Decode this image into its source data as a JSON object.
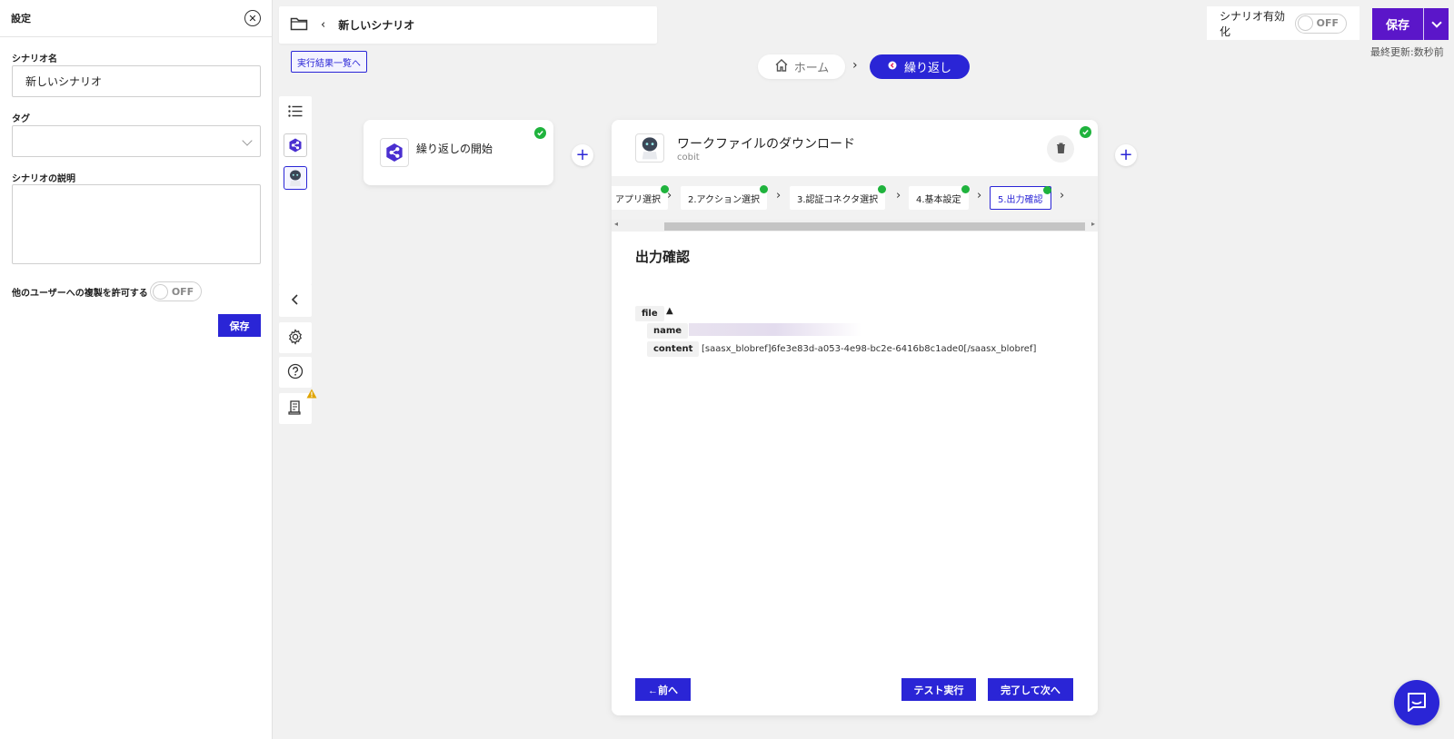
{
  "settings": {
    "title": "設定",
    "scenario_name_label": "シナリオ名",
    "scenario_name_value": "新しいシナリオ",
    "tag_label": "タグ",
    "tag_value": "",
    "description_label": "シナリオの説明",
    "description_value": "",
    "allow_copy_label": "他のユーザーへの複製を許可する",
    "allow_copy_toggle": "OFF",
    "save_label": "保存"
  },
  "topbar": {
    "scenario_name": "新しいシナリオ",
    "results_link": "実行結果一覧へ"
  },
  "breadcrumb": {
    "home": "ホーム",
    "current": "繰り返し"
  },
  "header_right": {
    "enable_label": "シナリオ有効化",
    "enable_toggle": "OFF",
    "save_label": "保存",
    "last_updated": "最終更新:数秒前"
  },
  "nodes": {
    "start_title": "繰り返しの開始",
    "main_title": "ワークファイルのダウンロード",
    "main_subtitle": "cobit"
  },
  "steps": [
    {
      "label": "アプリ選択"
    },
    {
      "label": "2.アクション選択"
    },
    {
      "label": "3.認証コネクタ選択"
    },
    {
      "label": "4.基本設定"
    },
    {
      "label": "5.出力確認"
    }
  ],
  "output": {
    "title": "出力確認",
    "root_key": "file",
    "name_key": "name",
    "content_key": "content",
    "content_value": "[saasx_blobref]6fe3e83d-a053-4e98-bc2e-6416b8c1ade0[/saasx_blobref]"
  },
  "buttons": {
    "prev": "←前へ",
    "test": "テスト実行",
    "next": "完了して次へ"
  },
  "colors": {
    "accent": "#2a25d6",
    "save_purple": "#5b16c9",
    "success": "#1fb33d"
  }
}
